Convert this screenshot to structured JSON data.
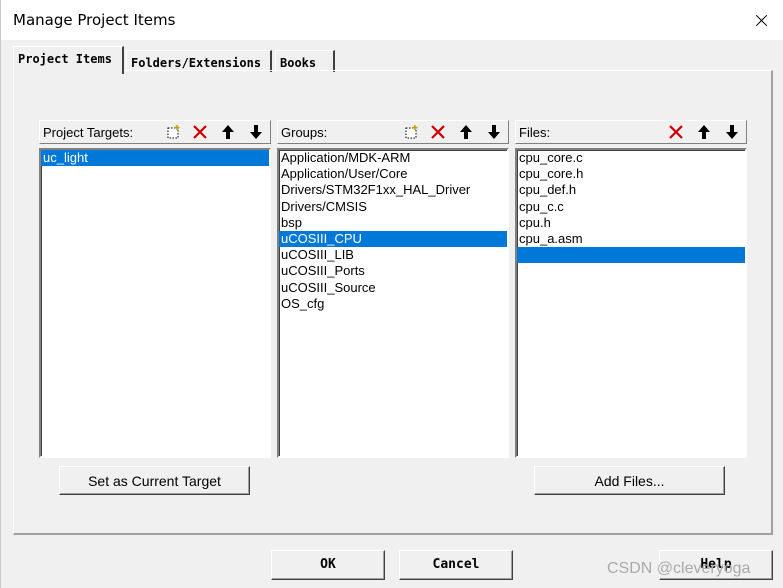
{
  "window": {
    "title": "Manage Project Items"
  },
  "tabs": [
    {
      "label": "Project Items",
      "active": true
    },
    {
      "label": "Folders/Extensions",
      "active": false
    },
    {
      "label": "Books",
      "active": false
    }
  ],
  "targets": {
    "label": "Project Targets:",
    "items": [
      "uc_light"
    ],
    "selected": "uc_light",
    "set_current_button": "Set as Current Target"
  },
  "groups": {
    "label": "Groups:",
    "items": [
      "Application/MDK-ARM",
      "Application/User/Core",
      "Drivers/STM32F1xx_HAL_Driver",
      "Drivers/CMSIS",
      "bsp",
      "uCOSIII_CPU",
      "uCOSIII_LIB",
      "uCOSIII_Ports",
      "uCOSIII_Source",
      "OS_cfg"
    ],
    "selected": "uCOSIII_CPU"
  },
  "files": {
    "label": "Files:",
    "items": [
      "cpu_core.c",
      "cpu_core.h",
      "cpu_def.h",
      "cpu_c.c",
      "cpu.h",
      "cpu_a.asm",
      ""
    ],
    "selected_index": 6,
    "add_button": "Add Files..."
  },
  "footer": {
    "ok": "OK",
    "cancel": "Cancel",
    "help": "Help"
  },
  "watermark": "CSDN @cleveryoga",
  "icons": [
    "new-item-icon",
    "delete-icon",
    "move-up-icon",
    "move-down-icon",
    "close-icon"
  ],
  "colors": {
    "selection": "#0078d7",
    "delete_red": "#cc0000",
    "face": "#f0f0f0"
  }
}
